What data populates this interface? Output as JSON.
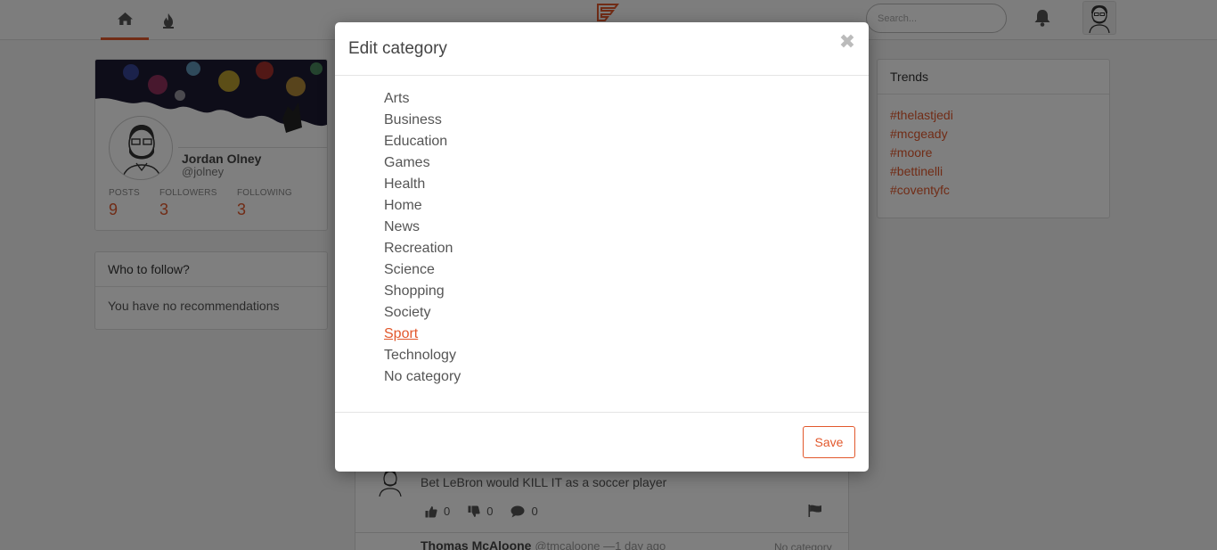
{
  "search": {
    "placeholder": "Search..."
  },
  "profile": {
    "name": "Jordan Olney",
    "handle": "@jolney",
    "stats": [
      {
        "label": "POSTS",
        "value": "9"
      },
      {
        "label": "FOLLOWERS",
        "value": "3"
      },
      {
        "label": "FOLLOWING",
        "value": "3"
      }
    ]
  },
  "who_to_follow": {
    "title": "Who to follow?",
    "empty_text": "You have no recommendations"
  },
  "trends": {
    "title": "Trends",
    "items": [
      "#thelastjedi",
      "#mcgeady",
      "#moore",
      "#bettinelli",
      "#coventyfc"
    ]
  },
  "feed": {
    "post1": {
      "text": "Bet LeBron would KILL IT as a soccer player",
      "likes": "0",
      "dislikes": "0",
      "comments": "0"
    },
    "post2": {
      "author": "Thomas McAloone",
      "meta": "@tmcaloone —1 day ago",
      "category": "No category"
    }
  },
  "modal": {
    "title": "Edit category",
    "close_glyph": "✖",
    "categories": [
      "Arts",
      "Business",
      "Education",
      "Games",
      "Health",
      "Home",
      "News",
      "Recreation",
      "Science",
      "Shopping",
      "Society",
      "Sport",
      "Technology",
      "No category"
    ],
    "selected": "Sport",
    "save_label": "Save"
  },
  "colors": {
    "accent": "#e2582c"
  }
}
